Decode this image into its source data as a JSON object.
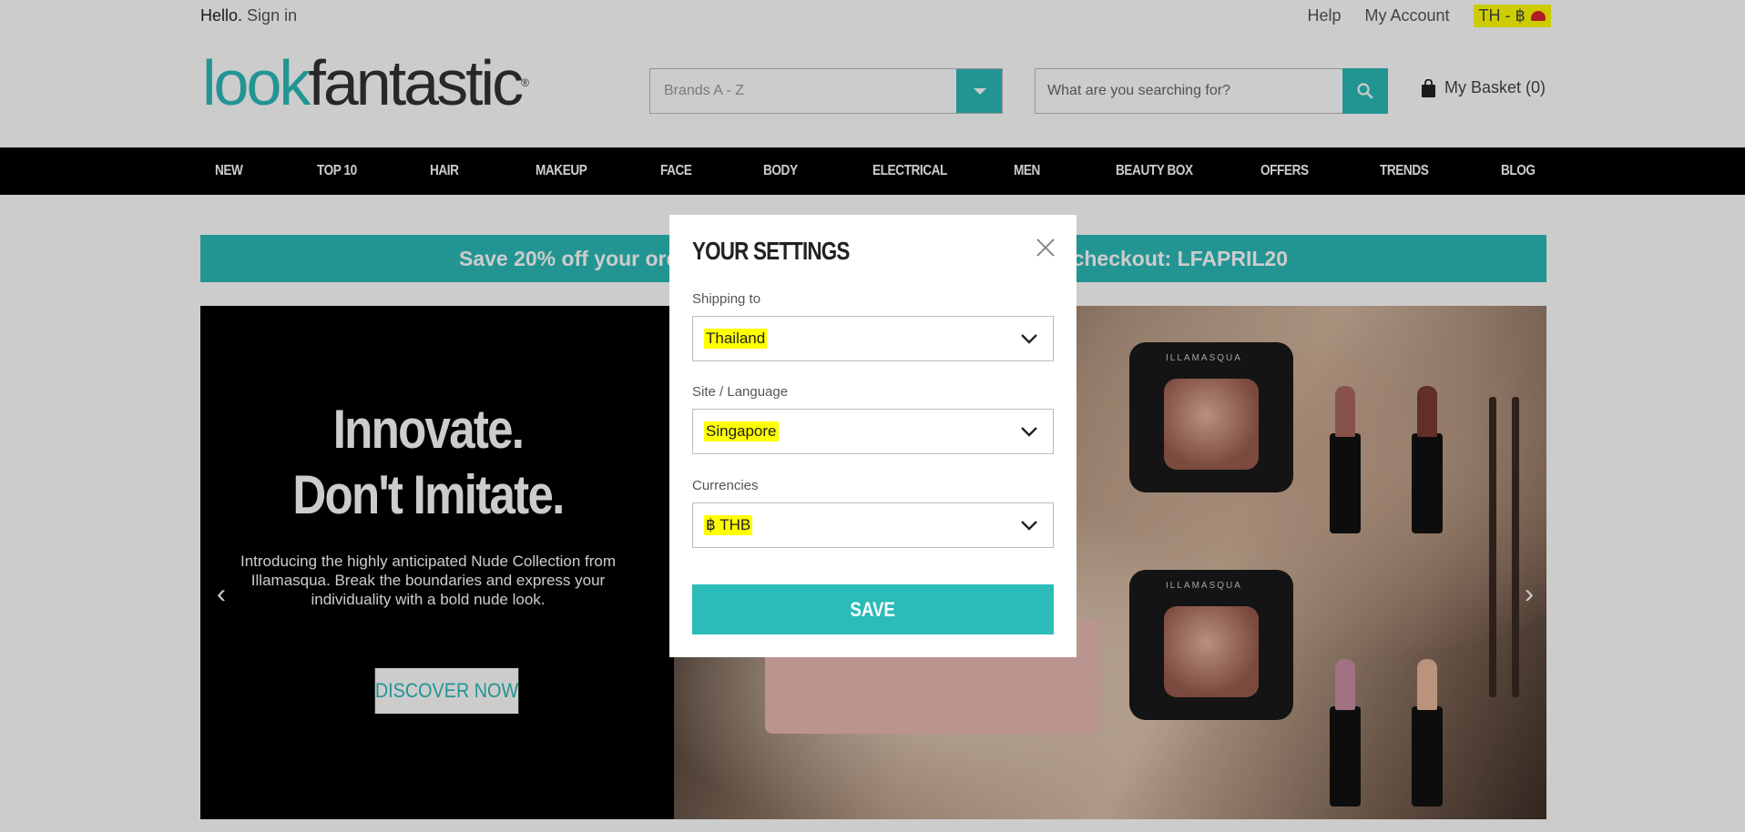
{
  "topbar": {
    "hello": "Hello.",
    "signin": "Sign in",
    "help": "Help",
    "account": "My Account",
    "locale": "TH - ฿"
  },
  "logo": {
    "part1": "look",
    "part2": "fantastic",
    "reg": "®"
  },
  "brands": {
    "value": "Brands A - Z"
  },
  "search": {
    "placeholder": "What are you searching for?"
  },
  "basket": {
    "label": "My Basket (0)"
  },
  "nav": {
    "items": [
      "NEW",
      "TOP 10",
      "HAIR",
      "MAKEUP",
      "FACE",
      "BODY",
      "ELECTRICAL",
      "MEN",
      "BEAUTY BOX",
      "OFFERS",
      "TRENDS",
      "BLOG"
    ]
  },
  "promo": {
    "text": "Save 20% off your order (exclusions apply) - Use this code at checkout: LFAPRIL20"
  },
  "hero": {
    "title_line1": "Innovate.",
    "title_line2": "Don't Imitate.",
    "description": "Introducing the highly anticipated Nude Collection from Illamasqua. Break the boundaries and express your individuality with a bold nude look.",
    "cta": "DISCOVER NOW",
    "product_brand": "ILLAMASQUA",
    "prev": "‹",
    "next": "›"
  },
  "modal": {
    "title": "YOUR SETTINGS",
    "shipping_label": "Shipping to",
    "shipping_value": "Thailand",
    "site_label": "Site / Language",
    "site_value": "Singapore",
    "currency_label": "Currencies",
    "currency_value": "฿ THB",
    "save": "SAVE"
  },
  "colors": {
    "accent": "#2bbbb8",
    "highlight": "#ffff00",
    "nav_bg": "#000000"
  }
}
